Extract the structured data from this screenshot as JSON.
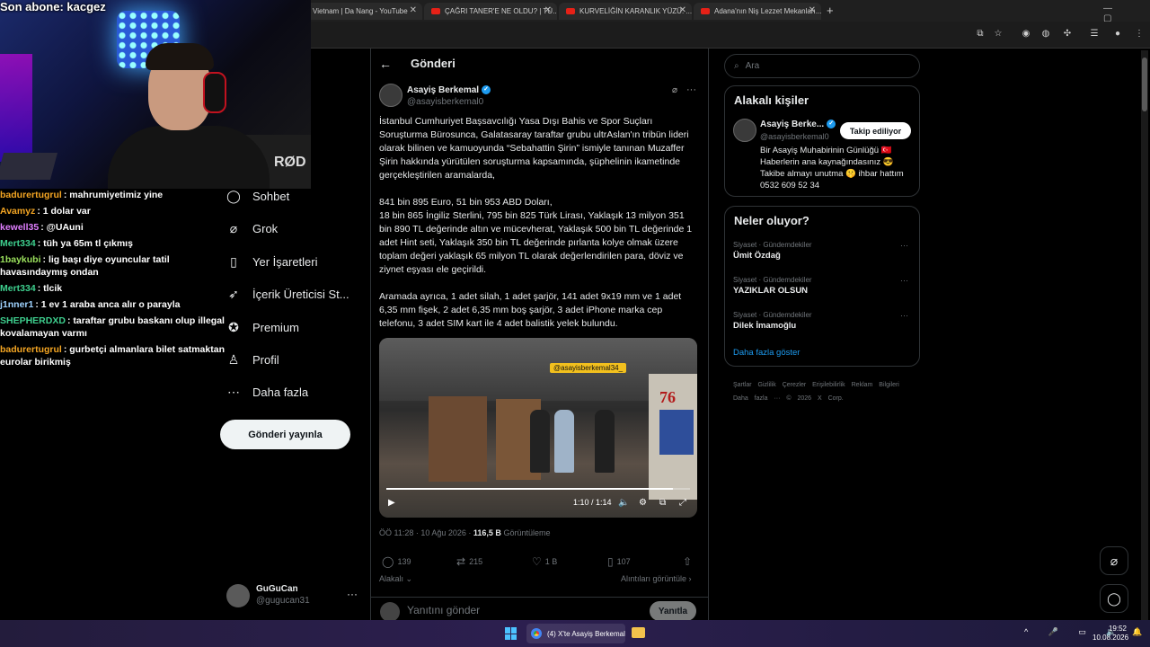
{
  "overlay": {
    "subscriber_line": "Son abone: kacgez",
    "chair_text": "RØD",
    "chat": [
      {
        "user": "badurertugrul",
        "text": ": mahrumiyetimiz yine",
        "color": "#f5a623"
      },
      {
        "user": "Avamyz",
        "text": ": 1 dolar var",
        "color": "#f5a623"
      },
      {
        "user": "kewell35",
        "text": ": @UAuni",
        "color": "#e07fff"
      },
      {
        "user": "Mert334",
        "text": ": tüh ya 65m tl çıkmış",
        "color": "#3ecf8e"
      },
      {
        "user": "1baykubi",
        "text": ": lig başı diye oyuncular tatil havasındaymış ondan",
        "color": "#9be15d"
      },
      {
        "user": "Mert334",
        "text": ": tlcik",
        "color": "#3ecf8e"
      },
      {
        "user": "j1nner1",
        "text": ": 1 ev 1 araba anca alır o parayla",
        "color": "#9fd3ff"
      },
      {
        "user": "SHEPHERDXD",
        "text": ": taraftar grubu baskanı olup illegal kovalamayan varmı",
        "color": "#3ecf8e"
      },
      {
        "user": "badurertugrul",
        "text": ": gurbetçi almanlara bilet satmaktan eurolar birikmiş",
        "color": "#f5a623"
      }
    ]
  },
  "browser": {
    "tabs": [
      {
        "label": "Vietnam | Da Nang - YouTube",
        "yt": false
      },
      {
        "label": "ÇAĞRI TANER'E NE OLDU? | TÜ...",
        "yt": true
      },
      {
        "label": "KURVELİĞİN KARANLIK YÜZÜ: ...",
        "yt": true
      },
      {
        "label": "Adana'nın Niş Lezzet Mekanları...",
        "yt": true
      }
    ],
    "newtab": "+",
    "window_controls": "— ▢ ✕"
  },
  "nav": {
    "items": [
      {
        "label": "Sohbet",
        "icon": "chat-icon"
      },
      {
        "label": "Grok",
        "icon": "grok-icon"
      },
      {
        "label": "Yer İşaretleri",
        "icon": "bookmark-icon"
      },
      {
        "label": "İçerik Üreticisi St...",
        "icon": "creator-studio-icon"
      },
      {
        "label": "Premium",
        "icon": "premium-icon"
      },
      {
        "label": "Profil",
        "icon": "profile-icon"
      },
      {
        "label": "Daha fazla",
        "icon": "more-icon"
      }
    ],
    "post_button": "Gönderi yayınla",
    "account": {
      "name": "GuGuCan",
      "handle": "@gugucan31"
    }
  },
  "post": {
    "header": "Gönderi",
    "author": {
      "name": "Asayiş Berkemal",
      "handle": "@asayisberkemal0"
    },
    "paragraphs": [
      "İstanbul Cumhuriyet Başsavcılığı Yasa Dışı Bahis ve Spor Suçları Soruşturma Bürosunca, Galatasaray taraftar grubu ultrAslan'ın tribün lideri olarak bilinen ve kamuoyunda “Sebahattin Şirin” ismiyle tanınan Muzaffer Şirin hakkında yürütülen soruşturma kapsamında, şüphelinin ikametinde gerçekleştirilen aramalarda,",
      "841 bin 895 Euro, 51 bin 953 ABD Doları,",
      "18 bin 865 İngiliz Sterlini, 795 bin 825 Türk Lirası, Yaklaşık 13 milyon 351 bin 890 TL değerinde altın ve mücevherat, Yaklaşık 500 bin TL değerinde 1 adet Hint seti, Yaklaşık 350 bin TL değerinde pırlanta kolye olmak üzere toplam değeri yaklaşık 65 milyon TL olarak değerlendirilen para, döviz ve ziynet eşyası ele geçirildi.",
      "Aramada ayrıca, 1 adet silah, 1 adet şarjör, 141 adet 9x19 mm ve 1 adet 6,35 mm fişek, 2 adet 6,35 mm boş şarjör, 3 adet iPhone marka cep telefonu, 3 adet SIM kart ile 4 adet balistik yelek bulundu."
    ],
    "video": {
      "watermark": "@asayisberkemal34_",
      "time": "1:10 / 1:14",
      "progress": 0.945,
      "sign_number": "76"
    },
    "timestamp": "ÖÖ 11:28 · 10 Ağu 2026 · ",
    "views": "116,5 B",
    "views_label": " Görüntüleme",
    "actions": {
      "replies": "139",
      "reposts": "215",
      "likes": "1 B",
      "bookmarks": "107"
    },
    "relevant_label": "Alakalı",
    "quotes_label": "Alıntıları görüntüle",
    "reply_placeholder": "Yanıtını gönder",
    "reply_button": "Yanıtla"
  },
  "sidebar": {
    "search_placeholder": "Ara",
    "relevant": {
      "title": "Alakalı kişiler",
      "name": "Asayiş Berke...",
      "handle": "@asayisberkemal0",
      "follow_label": "Takip ediliyor",
      "bio": "Bir Asayiş Muhabirinin Günlüğü 🇹🇷 Haberlerin ana kaynağındasınız 😎 Takibe almayı unutma 🤫 ihbar hattım 0532 609 52 34"
    },
    "news": {
      "title": "Neler oluyor?",
      "items": [
        {
          "category": "Siyaset · Gündemdekiler",
          "name": "Ümit Özdağ"
        },
        {
          "category": "Siyaset · Gündemdekiler",
          "name": "YAZIKLAR OLSUN"
        },
        {
          "category": "Siyaset · Gündemdekiler",
          "name": "Dilek İmamoğlu"
        }
      ],
      "show_more": "Daha fazla göster"
    },
    "footer": "Şartlar Gizlilik Çerezler Erişilebilirlik Reklam Bilgileri Daha fazla ··· © 2026 X Corp."
  },
  "taskbar": {
    "chrome_label": "(4) X'te Asayiş Berkemal",
    "time": "19:52",
    "date": "10.08.2026"
  }
}
